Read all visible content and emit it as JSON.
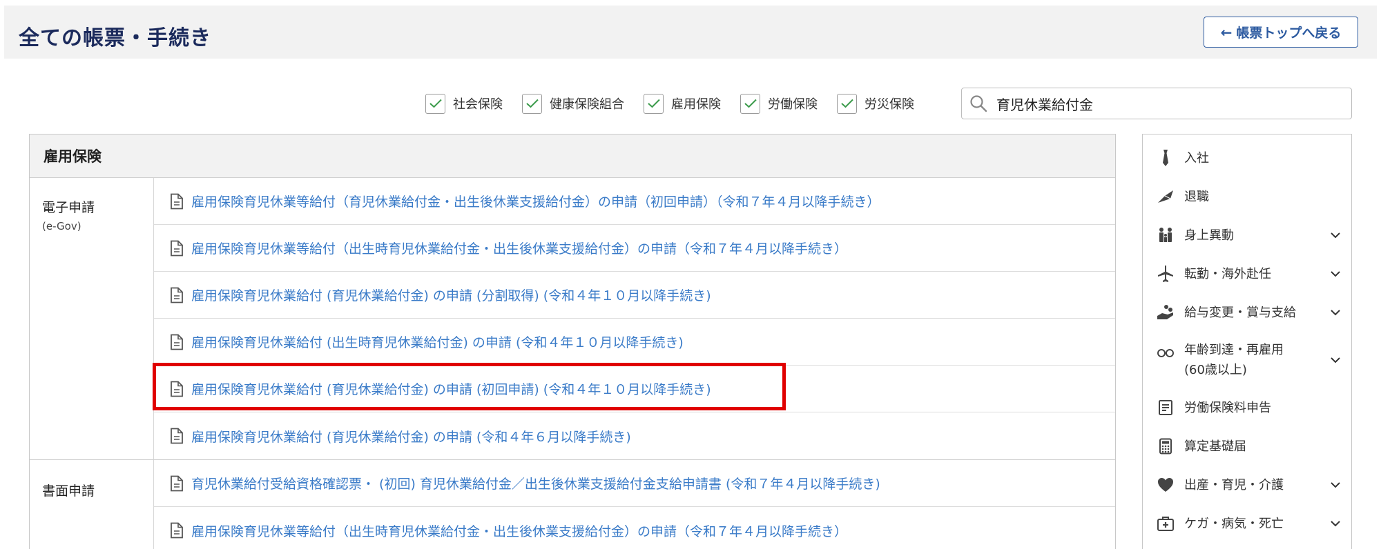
{
  "header": {
    "title": "全ての帳票・手続き",
    "back_label": "帳票トップへ戻る"
  },
  "filters": [
    {
      "label": "社会保険",
      "checked": true
    },
    {
      "label": "健康保険組合",
      "checked": true
    },
    {
      "label": "雇用保険",
      "checked": true
    },
    {
      "label": "労働保険",
      "checked": true
    },
    {
      "label": "労災保険",
      "checked": true
    }
  ],
  "search": {
    "value": "育児休業給付金"
  },
  "table": {
    "title": "雇用保険",
    "groups": [
      {
        "label": "電子申請",
        "sublabel": "(e-Gov)",
        "rows": [
          "雇用保険育児休業等給付（育児休業給付金・出生後休業支援給付金）の申請（初回申請）（令和７年４月以降手続き）",
          "雇用保険育児休業等給付（出生時育児休業給付金・出生後休業支援給付金）の申請（令和７年４月以降手続き）",
          "雇用保険育児休業給付 (育児休業給付金) の申請 (分割取得) (令和４年１０月以降手続き)",
          "雇用保険育児休業給付 (出生時育児休業給付金) の申請 (令和４年１０月以降手続き)",
          "雇用保険育児休業給付 (育児休業給付金) の申請 (初回申請) (令和４年１０月以降手続き)",
          "雇用保険育児休業給付 (育児休業給付金) の申請 (令和４年６月以降手続き)"
        ]
      },
      {
        "label": "書面申請",
        "sublabel": "",
        "rows": [
          "育児休業給付受給資格確認票・ (初回) 育児休業給付金／出生後休業支援給付金支給申請書 (令和７年４月以降手続き)",
          "雇用保険育児休業等給付（出生時育児休業給付金・出生後休業支援給付金）の申請（令和７年４月以降手続き）"
        ]
      }
    ]
  },
  "sidebar": {
    "items": [
      {
        "label": "入社",
        "icon": "necktie-icon",
        "expandable": false
      },
      {
        "label": "退職",
        "icon": "bouquet-icon",
        "expandable": false
      },
      {
        "label": "身上異動",
        "icon": "family-icon",
        "expandable": true
      },
      {
        "label": "転勤・海外赴任",
        "icon": "airplane-icon",
        "expandable": true
      },
      {
        "label": "給与変更・賞与支給",
        "icon": "coins-hand-icon",
        "expandable": true
      },
      {
        "label": "年齢到達・再雇用",
        "label2": "(60歳以上)",
        "icon": "glasses-icon",
        "expandable": true
      },
      {
        "label": "労働保険料申告",
        "icon": "document-lines-icon",
        "expandable": false
      },
      {
        "label": "算定基礎届",
        "icon": "calculator-icon",
        "expandable": false
      },
      {
        "label": "出産・育児・介護",
        "icon": "heart-icon",
        "expandable": true
      },
      {
        "label": "ケガ・病気・死亡",
        "icon": "first-aid-icon",
        "expandable": true
      }
    ]
  },
  "colors": {
    "title": "#1b2a5c",
    "link": "#3a7bc8",
    "accent_button": "#2c5aa0",
    "check": "#3a9a4a",
    "highlight": "#e00000"
  }
}
